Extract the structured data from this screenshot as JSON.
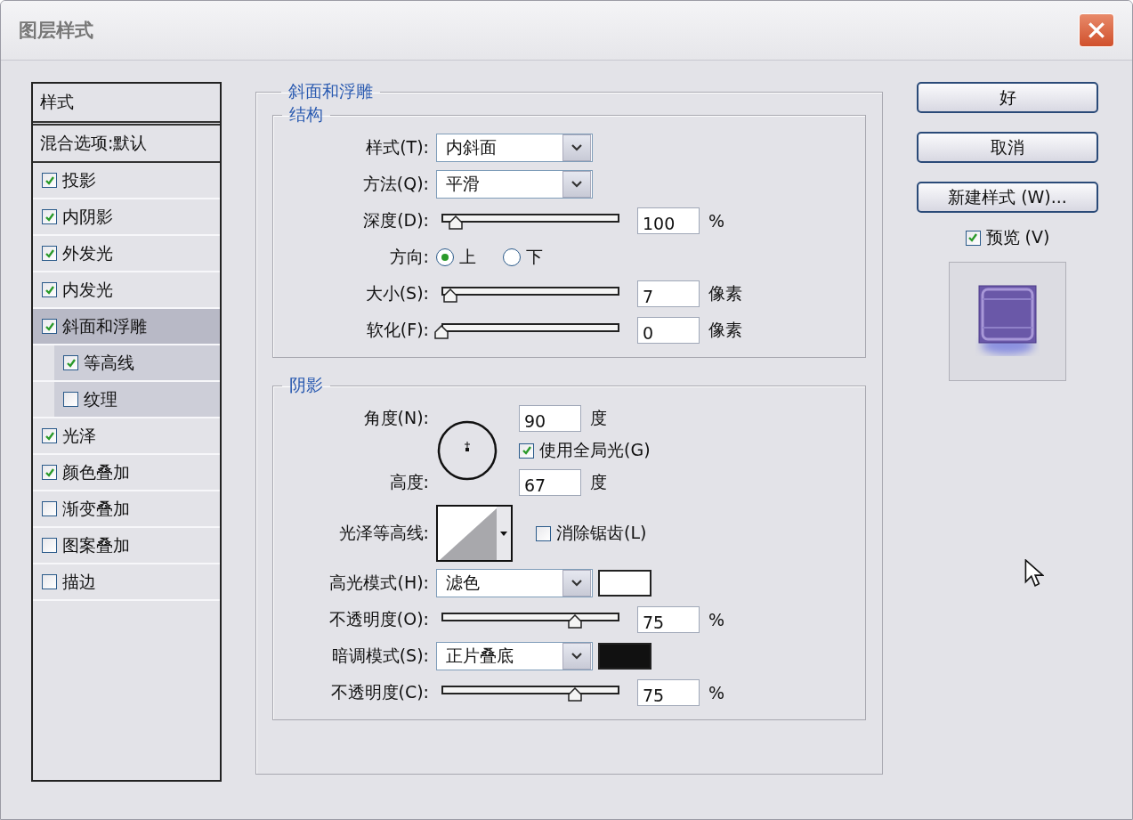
{
  "window": {
    "title": "图层样式"
  },
  "styles_list": {
    "header": "样式",
    "blend_options": "混合选项:默认",
    "items": [
      {
        "label": "投影",
        "checked": true,
        "selected": false
      },
      {
        "label": "内阴影",
        "checked": true,
        "selected": false
      },
      {
        "label": "外发光",
        "checked": true,
        "selected": false
      },
      {
        "label": "内发光",
        "checked": true,
        "selected": false
      },
      {
        "label": "斜面和浮雕",
        "checked": true,
        "selected": true,
        "children": [
          {
            "label": "等高线",
            "checked": true,
            "selected": false
          },
          {
            "label": "纹理",
            "checked": false,
            "selected": false
          }
        ]
      },
      {
        "label": "光泽",
        "checked": true,
        "selected": false
      },
      {
        "label": "颜色叠加",
        "checked": true,
        "selected": false
      },
      {
        "label": "渐变叠加",
        "checked": false,
        "selected": false
      },
      {
        "label": "图案叠加",
        "checked": false,
        "selected": false
      },
      {
        "label": "描边",
        "checked": false,
        "selected": false
      }
    ]
  },
  "panel": {
    "title": "斜面和浮雕",
    "structure": {
      "title": "结构",
      "style": {
        "label": "样式(T):",
        "value": "内斜面"
      },
      "technique": {
        "label": "方法(Q):",
        "value": "平滑"
      },
      "depth": {
        "label": "深度(D):",
        "level": 0.08,
        "value": "100",
        "unit": "%"
      },
      "direction": {
        "label": "方向:",
        "options": [
          {
            "label": "上",
            "selected": true
          },
          {
            "label": "下",
            "selected": false
          }
        ]
      },
      "size": {
        "label": "大小(S):",
        "level": 0.05,
        "value": "7",
        "unit": "像素"
      },
      "soften": {
        "label": "软化(F):",
        "level": 0,
        "value": "0",
        "unit": "像素"
      }
    },
    "shading": {
      "title": "阴影",
      "angle": {
        "label": "角度(N):",
        "value": "90",
        "unit": "度"
      },
      "global_light": {
        "label": "使用全局光(G)",
        "checked": true
      },
      "altitude": {
        "label": "高度:",
        "value": "67",
        "unit": "度"
      },
      "gloss_contour": {
        "label": "光泽等高线:"
      },
      "anti_aliased": {
        "label": "消除锯齿(L)",
        "checked": false
      },
      "highlight_mode": {
        "label": "高光模式(H):",
        "value": "滤色",
        "color": "#ffffff"
      },
      "highlight_opacity": {
        "label": "不透明度(O):",
        "level": 0.75,
        "value": "75",
        "unit": "%"
      },
      "shadow_mode": {
        "label": "暗调模式(S):",
        "value": "正片叠底",
        "color": "#111111"
      },
      "shadow_opacity": {
        "label": "不透明度(C):",
        "level": 0.75,
        "value": "75",
        "unit": "%"
      }
    }
  },
  "buttons": [
    "好",
    "取消",
    "新建样式 (W)..."
  ],
  "preview": {
    "label": "预览 (V)",
    "checked": true
  }
}
